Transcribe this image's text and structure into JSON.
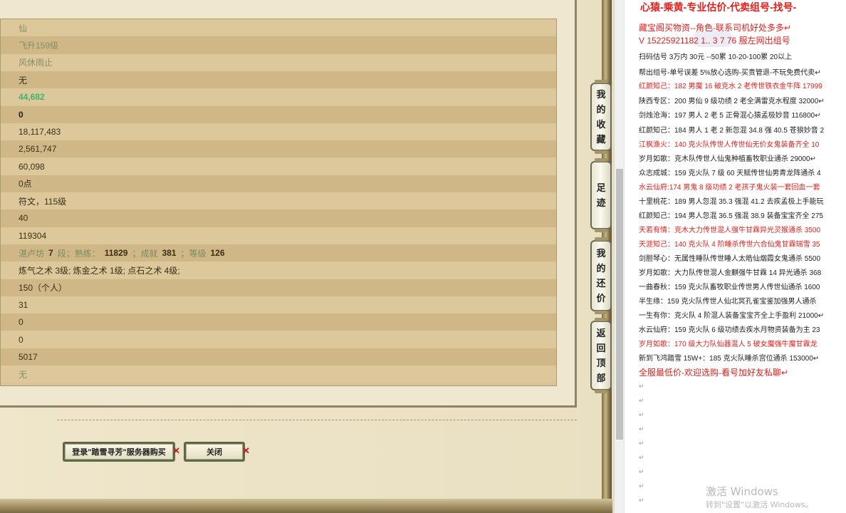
{
  "game": {
    "stats": [
      {
        "text": "仙",
        "style": "dim"
      },
      {
        "text": "飞升159级",
        "style": "dim"
      },
      {
        "text": "风休雨止",
        "style": "dim"
      },
      {
        "text": "无",
        "style": "dk"
      },
      {
        "text": "44,682",
        "style": "grn"
      },
      {
        "text": "0",
        "style": "blk"
      },
      {
        "text": "18,117,483",
        "style": "dk"
      },
      {
        "text": "2,561,747",
        "style": "dk"
      },
      {
        "text": "60,098",
        "style": "dk"
      },
      {
        "text": "0点",
        "style": "dk"
      },
      {
        "text": "符文，115级",
        "style": "dk"
      },
      {
        "text": "40",
        "style": "dk"
      },
      {
        "text": "119304",
        "style": "dk"
      },
      {
        "text": "",
        "style": "seg"
      },
      {
        "text": "炼气之术 3级; 炼金之术 1级; 点石之术 4级;",
        "style": "dk"
      },
      {
        "text": "150（个人）",
        "style": "dk"
      },
      {
        "text": "31",
        "style": "dk"
      },
      {
        "text": "0",
        "style": "dk"
      },
      {
        "text": "0",
        "style": "dk"
      },
      {
        "text": "5017",
        "style": "dk"
      },
      {
        "text": "无",
        "style": "dim"
      }
    ],
    "segmented_row": {
      "label1": "湛卢坊",
      "val1": "7",
      "unit1": "段；熟练：",
      "val2": "11829",
      "label3": "；成就",
      "val3": "381",
      "label4": "；等级",
      "val4": "126"
    },
    "buttons": {
      "login_server": "登录\"踏雪寻芳\"服务器购买",
      "close": "关闭",
      "x_mark": "✕"
    },
    "side_tabs": {
      "favorites": [
        "我",
        "的",
        "收",
        "藏"
      ],
      "footprint": [
        "足",
        "迹"
      ],
      "bargain": [
        "我",
        "的",
        "还",
        "价"
      ],
      "back_top": [
        "返",
        "回",
        "顶",
        "部"
      ]
    }
  },
  "doc": {
    "title": "心猿-乘黄-专业估价-代卖组号-找号-",
    "lines": [
      {
        "text": "藏宝阁买物资--角色-联系司机好处多多↵",
        "color": "red",
        "size": "mid"
      },
      {
        "text": "V 15225921182   1.. 3   7   76 服左网出组号",
        "color": "red",
        "size": "mid"
      },
      {
        "text": "扫码估号 3万内 30元     --50累  10-20-100累  20以上",
        "color": "black"
      },
      {
        "text": "帮出组号-单号误差 5%放心选购-买贵管退-不玩免费代卖↵",
        "color": "black"
      },
      {
        "text": "红颜知己：182 男魔 16 破克水 2 老传世铁衣金牛阵 17999",
        "color": "red"
      },
      {
        "text": "陕西专区：200 男仙 9 级功绩 2 老全满雷克水程度 32000↵",
        "color": "black"
      },
      {
        "text": "剑烛沧海：197 男人 2 老 5 正骨混心猿孟极妙音 116800↵",
        "color": "black"
      },
      {
        "text": "红颜知己：184 男人 1 老 2 新忽混 34.8 强 40.5 苍狼妙音 2",
        "color": "black"
      },
      {
        "text": "江枫渔火：140 克火队传世人传世仙无价女鬼装备齐全 10",
        "color": "red"
      },
      {
        "text": "岁月如歌：克木队传世人仙鬼种植畜牧职业通杀 29000↵",
        "color": "black"
      },
      {
        "text": "众志成城：159 克火队 7 级 60 天赋传世仙男青龙阵通杀 4",
        "color": "black"
      },
      {
        "text": "水云仙府:174 男鬼 8 级功绩 2 老孩子鬼火装一套回血一套",
        "color": "red"
      },
      {
        "text": "十里桃花：189 男人忽混 35.3 强混 41.2 去疾孟极上手能玩",
        "color": "black"
      },
      {
        "text": "红颜知己：194 男人忽混 36.5 强混 38.9 装备宝宝齐全 275",
        "color": "black"
      },
      {
        "text": "天若有情：克木大力传世混人强牛甘霖异光灵猴通杀 3500",
        "color": "red"
      },
      {
        "text": "天涯知己：140 克火队 4 阶睡杀传世六合仙鬼甘霖瑞雪 35",
        "color": "red"
      },
      {
        "text": "剑胆琴心：无属性睡队传世睡人太皓仙烟霞女鬼通杀 5500",
        "color": "black"
      },
      {
        "text": "岁月如歌：大力队传世混人金麒强牛甘霖 14 异光通杀 368",
        "color": "black"
      },
      {
        "text": "一曲春秋：159 克火队畜牧职业传世男人传世仙通杀 1600",
        "color": "black"
      },
      {
        "text": "半生缘：159 克火队传世人仙北冥孔雀宝鉴加强男人通杀",
        "color": "black"
      },
      {
        "text": "一生有你：克火队 4 阶混人装备宝宝齐全上手盈利 21000↵",
        "color": "black"
      },
      {
        "text": "水云仙府：159 克火队 6 级功绩去疾水月物资装备为主 23",
        "color": "black"
      },
      {
        "text": "岁月如歌：170 级大力队仙器混人 5 破女魔强牛魔甘霖龙",
        "color": "red"
      },
      {
        "text": "新到飞鸿踏雪 15W+：185 克火队睡杀宫位通杀 153000↵",
        "color": "black"
      },
      {
        "text": "全服最低价-欢迎选购-看号加好友私聊↵",
        "color": "red",
        "size": "mid"
      }
    ],
    "para_mark": "↵",
    "watermark_title": "激活 Windows",
    "watermark_sub": "转到\"设置\"以激活 Windows。"
  }
}
